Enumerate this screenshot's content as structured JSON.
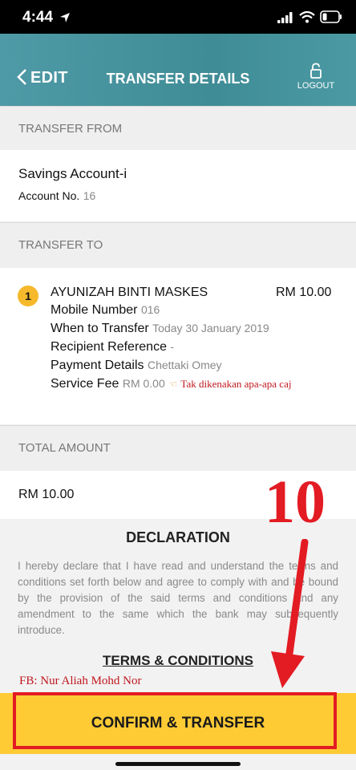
{
  "status_bar": {
    "time": "4:44"
  },
  "header": {
    "back_label": "EDIT",
    "title": "TRANSFER DETAILS",
    "logout_label": "LOGOUT"
  },
  "transfer_from": {
    "section_label": "TRANSFER FROM",
    "account_name": "Savings Account-i",
    "account_no_label": "Account No.",
    "account_no_value": "16"
  },
  "transfer_to": {
    "section_label": "TRANSFER TO",
    "index": "1",
    "recipient_name": "AYUNIZAH BINTI MASKES",
    "amount": "RM 10.00",
    "rows": [
      {
        "label": "Mobile Number",
        "value": "016"
      },
      {
        "label": "When to Transfer",
        "value": "Today 30 January 2019"
      },
      {
        "label": "Recipient Reference",
        "value": "-"
      },
      {
        "label": "Payment Details",
        "value": "Chettaki Omey"
      },
      {
        "label": "Service Fee",
        "value": "RM 0.00"
      }
    ],
    "annotation": "Tak dikenakan apa-apa caj"
  },
  "total": {
    "section_label": "TOTAL AMOUNT",
    "value": "RM 10.00"
  },
  "declaration": {
    "title": "DECLARATION",
    "text": "I hereby declare that I have read and understand the terms and conditions set forth below and agree to comply with and be bound by the provision of the said terms and conditions and any amendment to the same which the bank may subsequently introduce.",
    "terms_link": "TERMS & CONDITIONS"
  },
  "overlay": {
    "step_number": "10",
    "credit": "FB: Nur Aliah Mohd Nor",
    "accent_color": "#e31b23"
  },
  "confirm_button": {
    "label": "CONFIRM & TRANSFER",
    "color": "#fecb35"
  }
}
